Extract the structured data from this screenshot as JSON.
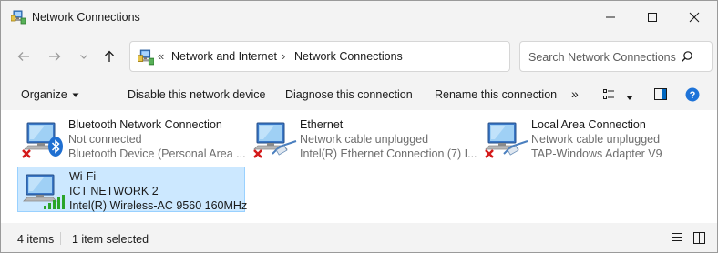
{
  "window": {
    "title": "Network Connections",
    "controls": [
      "minimize-icon",
      "maximize-icon",
      "close-icon"
    ]
  },
  "address": {
    "overflow": "«",
    "crumbs": [
      "Network and Internet",
      "Network Connections"
    ],
    "separator": "›"
  },
  "search": {
    "placeholder": "Search Network Connections"
  },
  "commands": {
    "organize": "Organize",
    "disable": "Disable this network device",
    "diagnose": "Diagnose this connection",
    "rename": "Rename this connection",
    "more": "»"
  },
  "connections": [
    {
      "name": "Bluetooth Network Connection",
      "status": "Not connected",
      "device": "Bluetooth Device (Personal Area ...",
      "icon": "bluetooth-adapter-icon",
      "error": true,
      "selected": false
    },
    {
      "name": "Ethernet",
      "status": "Network cable unplugged",
      "device": "Intel(R) Ethernet Connection (7) I...",
      "icon": "ethernet-adapter-icon",
      "error": true,
      "selected": false
    },
    {
      "name": "Local Area Connection",
      "status": "Network cable unplugged",
      "device": "TAP-Windows Adapter V9",
      "icon": "ethernet-adapter-icon",
      "error": true,
      "selected": false
    },
    {
      "name": "Wi-Fi",
      "status": "ICT NETWORK 2",
      "device": "Intel(R) Wireless-AC 9560 160MHz",
      "icon": "wifi-adapter-icon",
      "error": false,
      "selected": true
    }
  ],
  "status": {
    "count": "4 items",
    "selection": "1 item selected"
  },
  "colors": {
    "accent": "#0067c0",
    "selection_bg": "#cce8ff",
    "selection_border": "#99d1ff",
    "error_red": "#d41a1a",
    "signal_green": "#2aa52a"
  }
}
